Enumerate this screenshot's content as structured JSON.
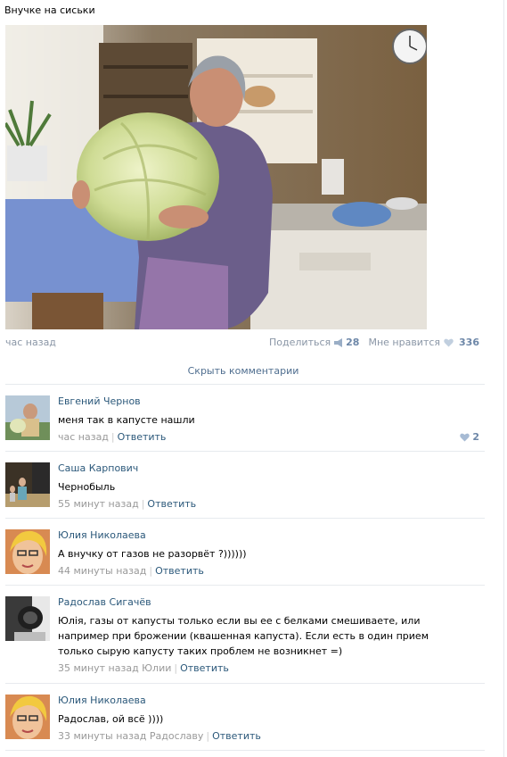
{
  "post": {
    "title": "Внучке на сиськи",
    "time": "час назад",
    "share_label": "Поделиться",
    "share_count": "28",
    "like_label": "Мне нравится",
    "like_count": "336",
    "hide_comments": "Скрыть комментарии"
  },
  "comments": [
    {
      "author": "Евгений Чернов",
      "text": "меня так в капусте нашли",
      "time": "час назад",
      "reply": "Ответить",
      "likes": "2"
    },
    {
      "author": "Саша Карпович",
      "text": "Чернобыль",
      "time": "55 минут назад",
      "reply": "Ответить"
    },
    {
      "author": "Юлия Николаева",
      "text": "А внучку от газов не разорвёт ?))))))",
      "time": "44 минуты назад",
      "reply": "Ответить"
    },
    {
      "author": "Радослав Сигачёв",
      "text": "Юлія, газы от капусты только если вы ее с белками смешиваете, или например при брожении (квашенная капуста). Если есть в один прием только сырую капусту таких проблем не возникнет =)",
      "time": "35 минут назад Юлии",
      "reply": "Ответить"
    },
    {
      "author": "Юлия Николаева",
      "text": "Радослав, ой всё ))))",
      "time": "33 минуты назад Радославу",
      "reply": "Ответить"
    }
  ],
  "icons": {
    "share": "megaphone-icon",
    "like": "heart-icon"
  },
  "colors": {
    "link": "#2b587a",
    "meta": "#8a96a6",
    "count": "#6d87a8",
    "separator": "#e7eaee"
  }
}
